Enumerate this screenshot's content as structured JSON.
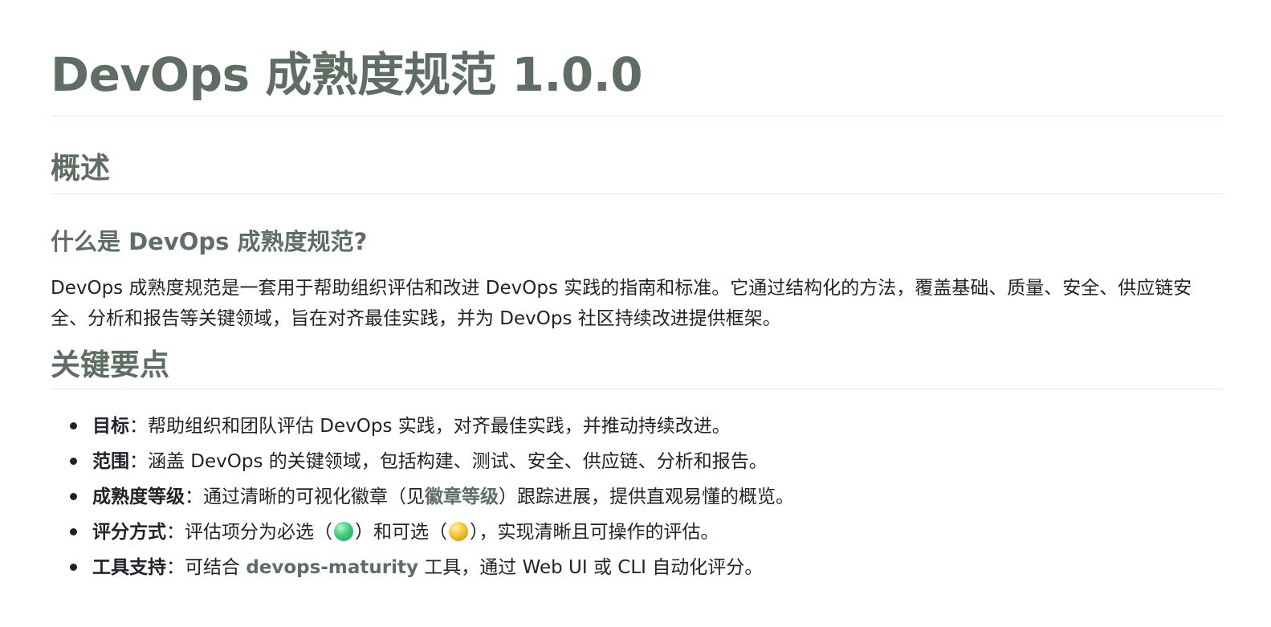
{
  "title": "DevOps 成熟度规范 1.0.0",
  "overview": {
    "heading": "概述",
    "subheading": "什么是 DevOps 成熟度规范?",
    "paragraph": "DevOps 成熟度规范是一套用于帮助组织评估和改进 DevOps 实践的指南和标准。它通过结构化的方法，覆盖基础、质量、安全、供应链安全、分析和报告等关键领域，旨在对齐最佳实践，并为 DevOps 社区持续改进提供框架。"
  },
  "key_points": {
    "heading": "关键要点",
    "items": [
      {
        "term": "目标",
        "sep": "：",
        "text": "帮助组织和团队评估 DevOps 实践，对齐最佳实践，并推动持续改进。"
      },
      {
        "term": "范围",
        "sep": "：",
        "text": "涵盖 DevOps 的关键领域，包括构建、测试、安全、供应链、分析和报告。"
      },
      {
        "term": "成熟度等级",
        "sep": "：",
        "text_before": "通过清晰的可视化徽章（见",
        "link": "徽章等级",
        "text_after": "）跟踪进展，提供直观易懂的概览。"
      },
      {
        "term": "评分方式",
        "sep": "：",
        "text_before": "评估项分为必选（",
        "mid": "）和可选（",
        "text_after": "），实现清晰且可操作的评估。",
        "required_icon": "green-ball-icon",
        "optional_icon": "yellow-ball-icon"
      },
      {
        "term": "工具支持",
        "sep": "：",
        "text_before": "可结合 ",
        "link": "devops-maturity",
        "text_after": " 工具，通过 Web UI 或 CLI 自动化评分。"
      }
    ]
  },
  "colors": {
    "heading": "#5f6e64",
    "text": "#1f2328",
    "rule": "#e4e8e6",
    "required": "#3fcf7d",
    "optional": "#f5c531"
  }
}
